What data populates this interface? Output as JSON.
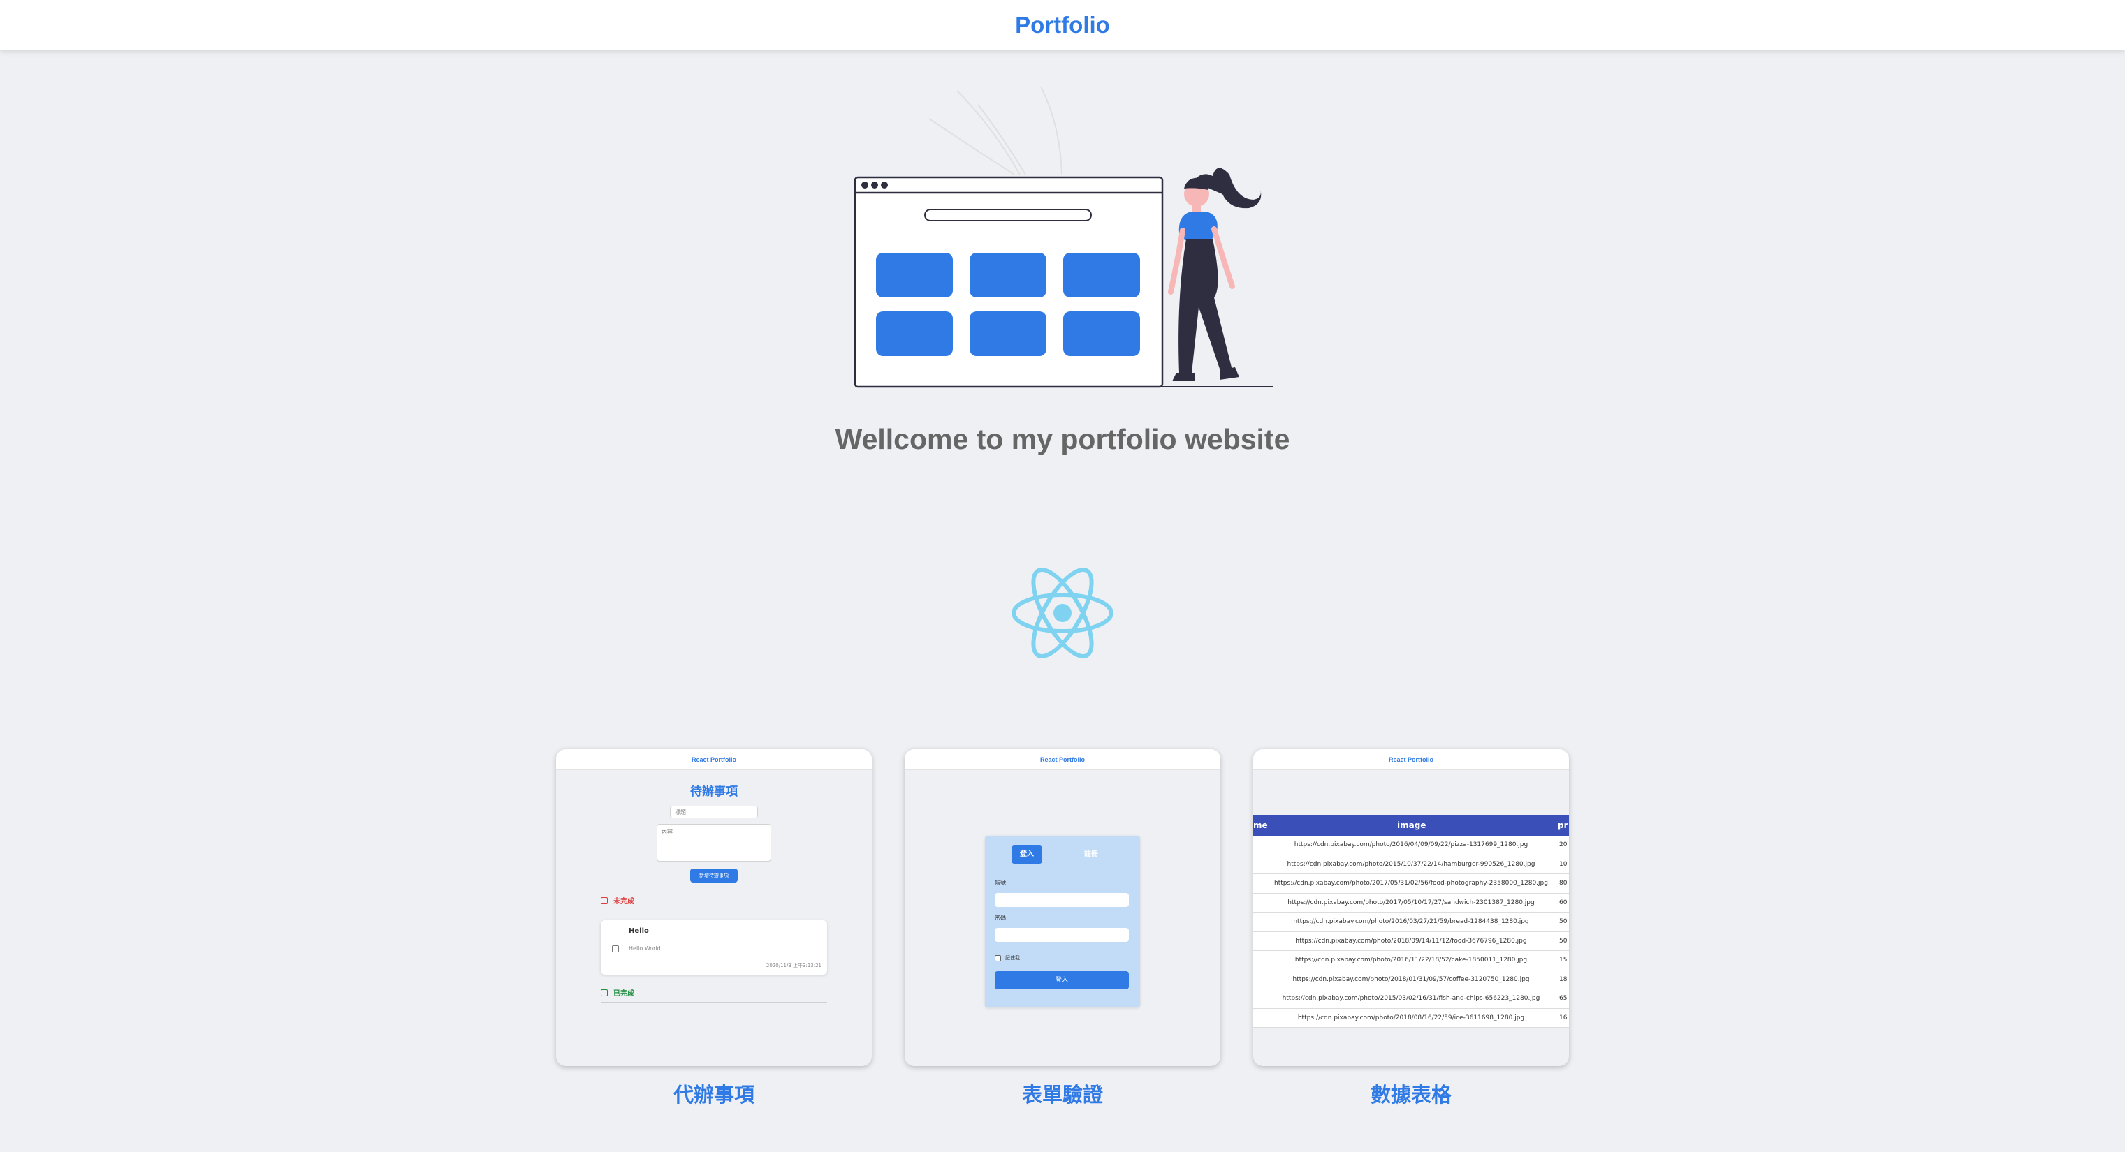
{
  "header": {
    "brand": "Portfolio"
  },
  "hero": {
    "welcome": "Wellcome to my portfolio website"
  },
  "colors": {
    "accent": "#2f7ae5",
    "background": "#eff0f4",
    "react": "#7fd3f1",
    "table_header": "#3a4fb8"
  },
  "projects": [
    {
      "caption": "代辦事項",
      "preview": {
        "mini_title": "React Portfolio",
        "title": "待辦事項",
        "input_placeholder": "標題",
        "textarea_placeholder": "內容",
        "add_button": "新增待辦事項",
        "section_incomplete": "未完成",
        "section_complete": "已完成",
        "item": {
          "title": "Hello",
          "content": "Hello World",
          "date": "2020/11/3 上午3:13:21"
        }
      }
    },
    {
      "caption": "表單驗證",
      "preview": {
        "mini_title": "React Portfolio",
        "tab_login": "登入",
        "tab_register": "註冊",
        "label_account": "帳號",
        "label_password": "密碼",
        "remember": "記住我",
        "submit": "登入"
      }
    },
    {
      "caption": "數據表格",
      "preview": {
        "mini_title": "React Portfolio",
        "columns": [
          "me",
          "image",
          "pr"
        ],
        "rows": [
          {
            "url": "https://cdn.pixabay.com/photo/2016/04/09/09/22/pizza-1317699_1280.jpg",
            "price": "20"
          },
          {
            "url": "https://cdn.pixabay.com/photo/2015/10/37/22/14/hamburger-990526_1280.jpg",
            "price": "10"
          },
          {
            "url": "https://cdn.pixabay.com/photo/2017/05/31/02/56/food-photography-2358000_1280.jpg",
            "price": "80"
          },
          {
            "url": "https://cdn.pixabay.com/photo/2017/05/10/17/27/sandwich-2301387_1280.jpg",
            "price": "60"
          },
          {
            "url": "https://cdn.pixabay.com/photo/2016/03/27/21/59/bread-1284438_1280.jpg",
            "price": "50"
          },
          {
            "url": "https://cdn.pixabay.com/photo/2018/09/14/11/12/food-3676796_1280.jpg",
            "price": "50"
          },
          {
            "url": "https://cdn.pixabay.com/photo/2016/11/22/18/52/cake-1850011_1280.jpg",
            "price": "15"
          },
          {
            "url": "https://cdn.pixabay.com/photo/2018/01/31/09/57/coffee-3120750_1280.jpg",
            "price": "18"
          },
          {
            "url": "https://cdn.pixabay.com/photo/2015/03/02/16/31/fish-and-chips-656223_1280.jpg",
            "price": "65"
          },
          {
            "url": "https://cdn.pixabay.com/photo/2018/08/16/22/59/ice-3611698_1280.jpg",
            "price": "16"
          }
        ]
      }
    }
  ]
}
